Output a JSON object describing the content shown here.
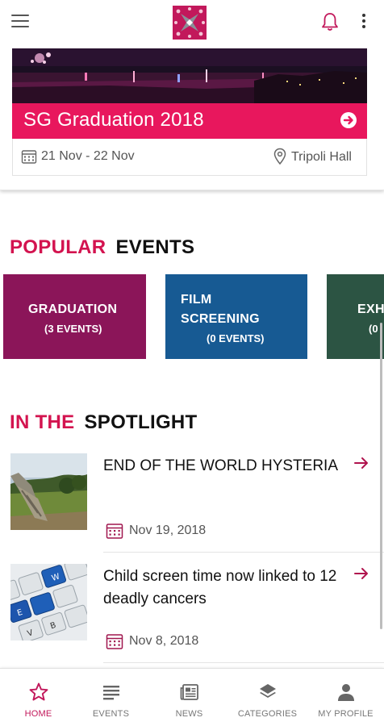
{
  "colors": {
    "accent": "#e8175d",
    "heading_accent": "#d3134f",
    "graduation_tile": "#8b1559",
    "film_tile": "#175a93",
    "exhibition_tile": "#2c5443"
  },
  "featured_event": {
    "title": "SG Graduation 2018",
    "date_range": "21 Nov - 22 Nov",
    "location": "Tripoli Hall"
  },
  "popular": {
    "heading_accent": "POPULAR",
    "heading_rest": "EVENTS",
    "tiles": [
      {
        "name": "GRADUATION",
        "count": "(3 EVENTS)"
      },
      {
        "name_line1": "FILM",
        "name_line2": "SCREENING",
        "count": "(0 EVENTS)"
      },
      {
        "name": "EXH",
        "count": "(0"
      }
    ]
  },
  "spotlight": {
    "heading_accent": "IN THE",
    "heading_rest": "SPOTLIGHT",
    "items": [
      {
        "headline": "END OF THE WORLD HYSTERIA",
        "date": "Nov 19, 2018",
        "thumb_icon": "pyramid-ruins-photo"
      },
      {
        "headline": "Child screen time now linked to 12 deadly cancers",
        "date": "Nov 8, 2018",
        "thumb_icon": "keyboard-photo"
      }
    ]
  },
  "bottom_nav": [
    {
      "label": "HOME",
      "icon": "star-icon",
      "active": true
    },
    {
      "label": "EVENTS",
      "icon": "list-icon",
      "active": false
    },
    {
      "label": "NEWS",
      "icon": "newspaper-icon",
      "active": false
    },
    {
      "label": "CATEGORIES",
      "icon": "layers-icon",
      "active": false
    },
    {
      "label": "MY PROFILE",
      "icon": "person-icon",
      "active": false
    }
  ]
}
